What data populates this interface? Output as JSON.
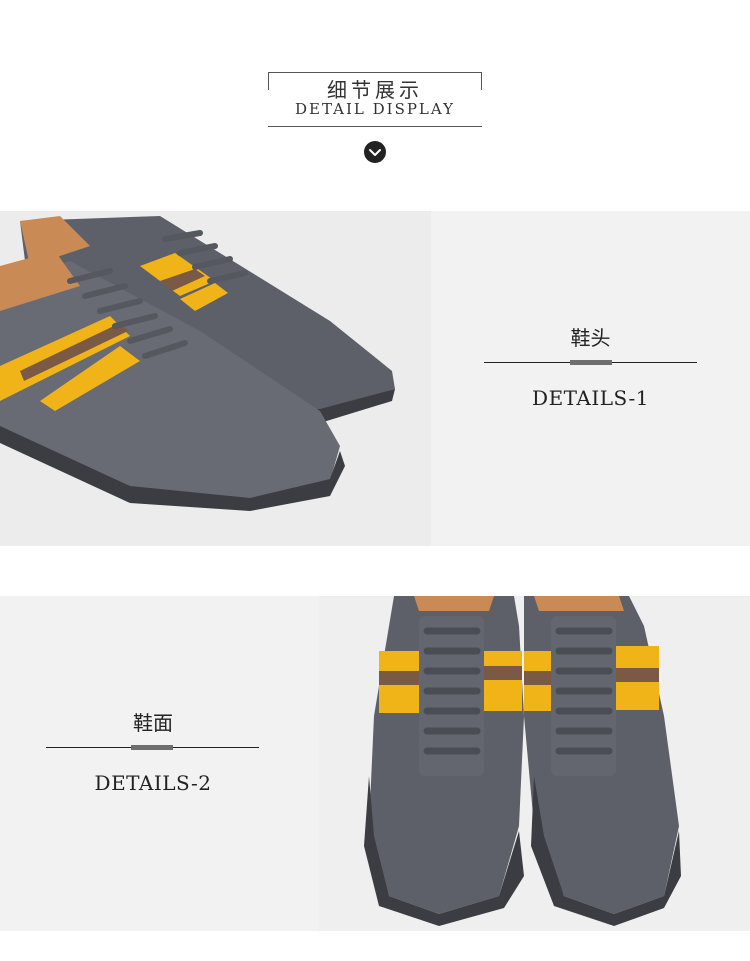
{
  "header": {
    "title_cn": "细节展示",
    "title_en": "DETAIL DISPLAY",
    "scroll_icon": "chevron-down-icon"
  },
  "details": [
    {
      "label_cn": "鞋头",
      "label_en": "DETAILS-1",
      "image_subject": "grey leather sneaker with yellow and brown stripes, side view"
    },
    {
      "label_cn": "鞋面",
      "label_en": "DETAILS-2",
      "image_subject": "pair of grey leather sneakers with laces, top view"
    }
  ],
  "colors": {
    "leather_grey": "#5d6069",
    "stripe_yellow": "#f0b419",
    "stripe_brown": "#7a5a44",
    "sole_dark": "#3b3d42",
    "lining_tan": "#c98a55",
    "panel_bg": "#f2f2f2"
  }
}
